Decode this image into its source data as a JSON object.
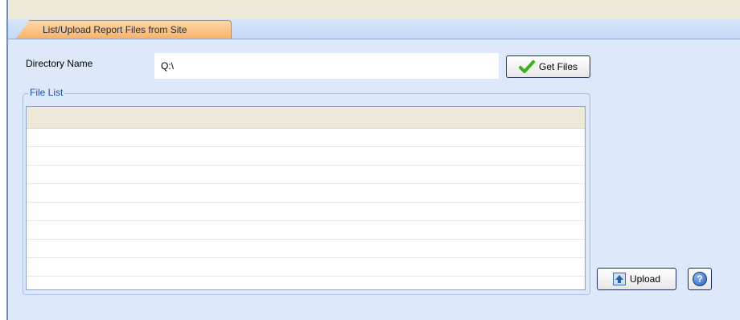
{
  "tabs": [
    {
      "label": "List/Upload Report Files from Site",
      "active": true
    }
  ],
  "directory": {
    "label": "Directory Name",
    "value": "Q:\\"
  },
  "buttons": {
    "get_files": "Get Files",
    "upload": "Upload"
  },
  "file_list": {
    "title": "File List",
    "rows": [
      "",
      "",
      "",
      "",
      "",
      "",
      "",
      "",
      ""
    ]
  },
  "icons": {
    "get_files": "checkmark-icon",
    "upload": "upload-icon",
    "help": "help-icon"
  },
  "colors": {
    "tab": "#f7b26a",
    "panel": "#dde9fb",
    "group_label": "#1d53b7",
    "check": "#3fae1f"
  }
}
